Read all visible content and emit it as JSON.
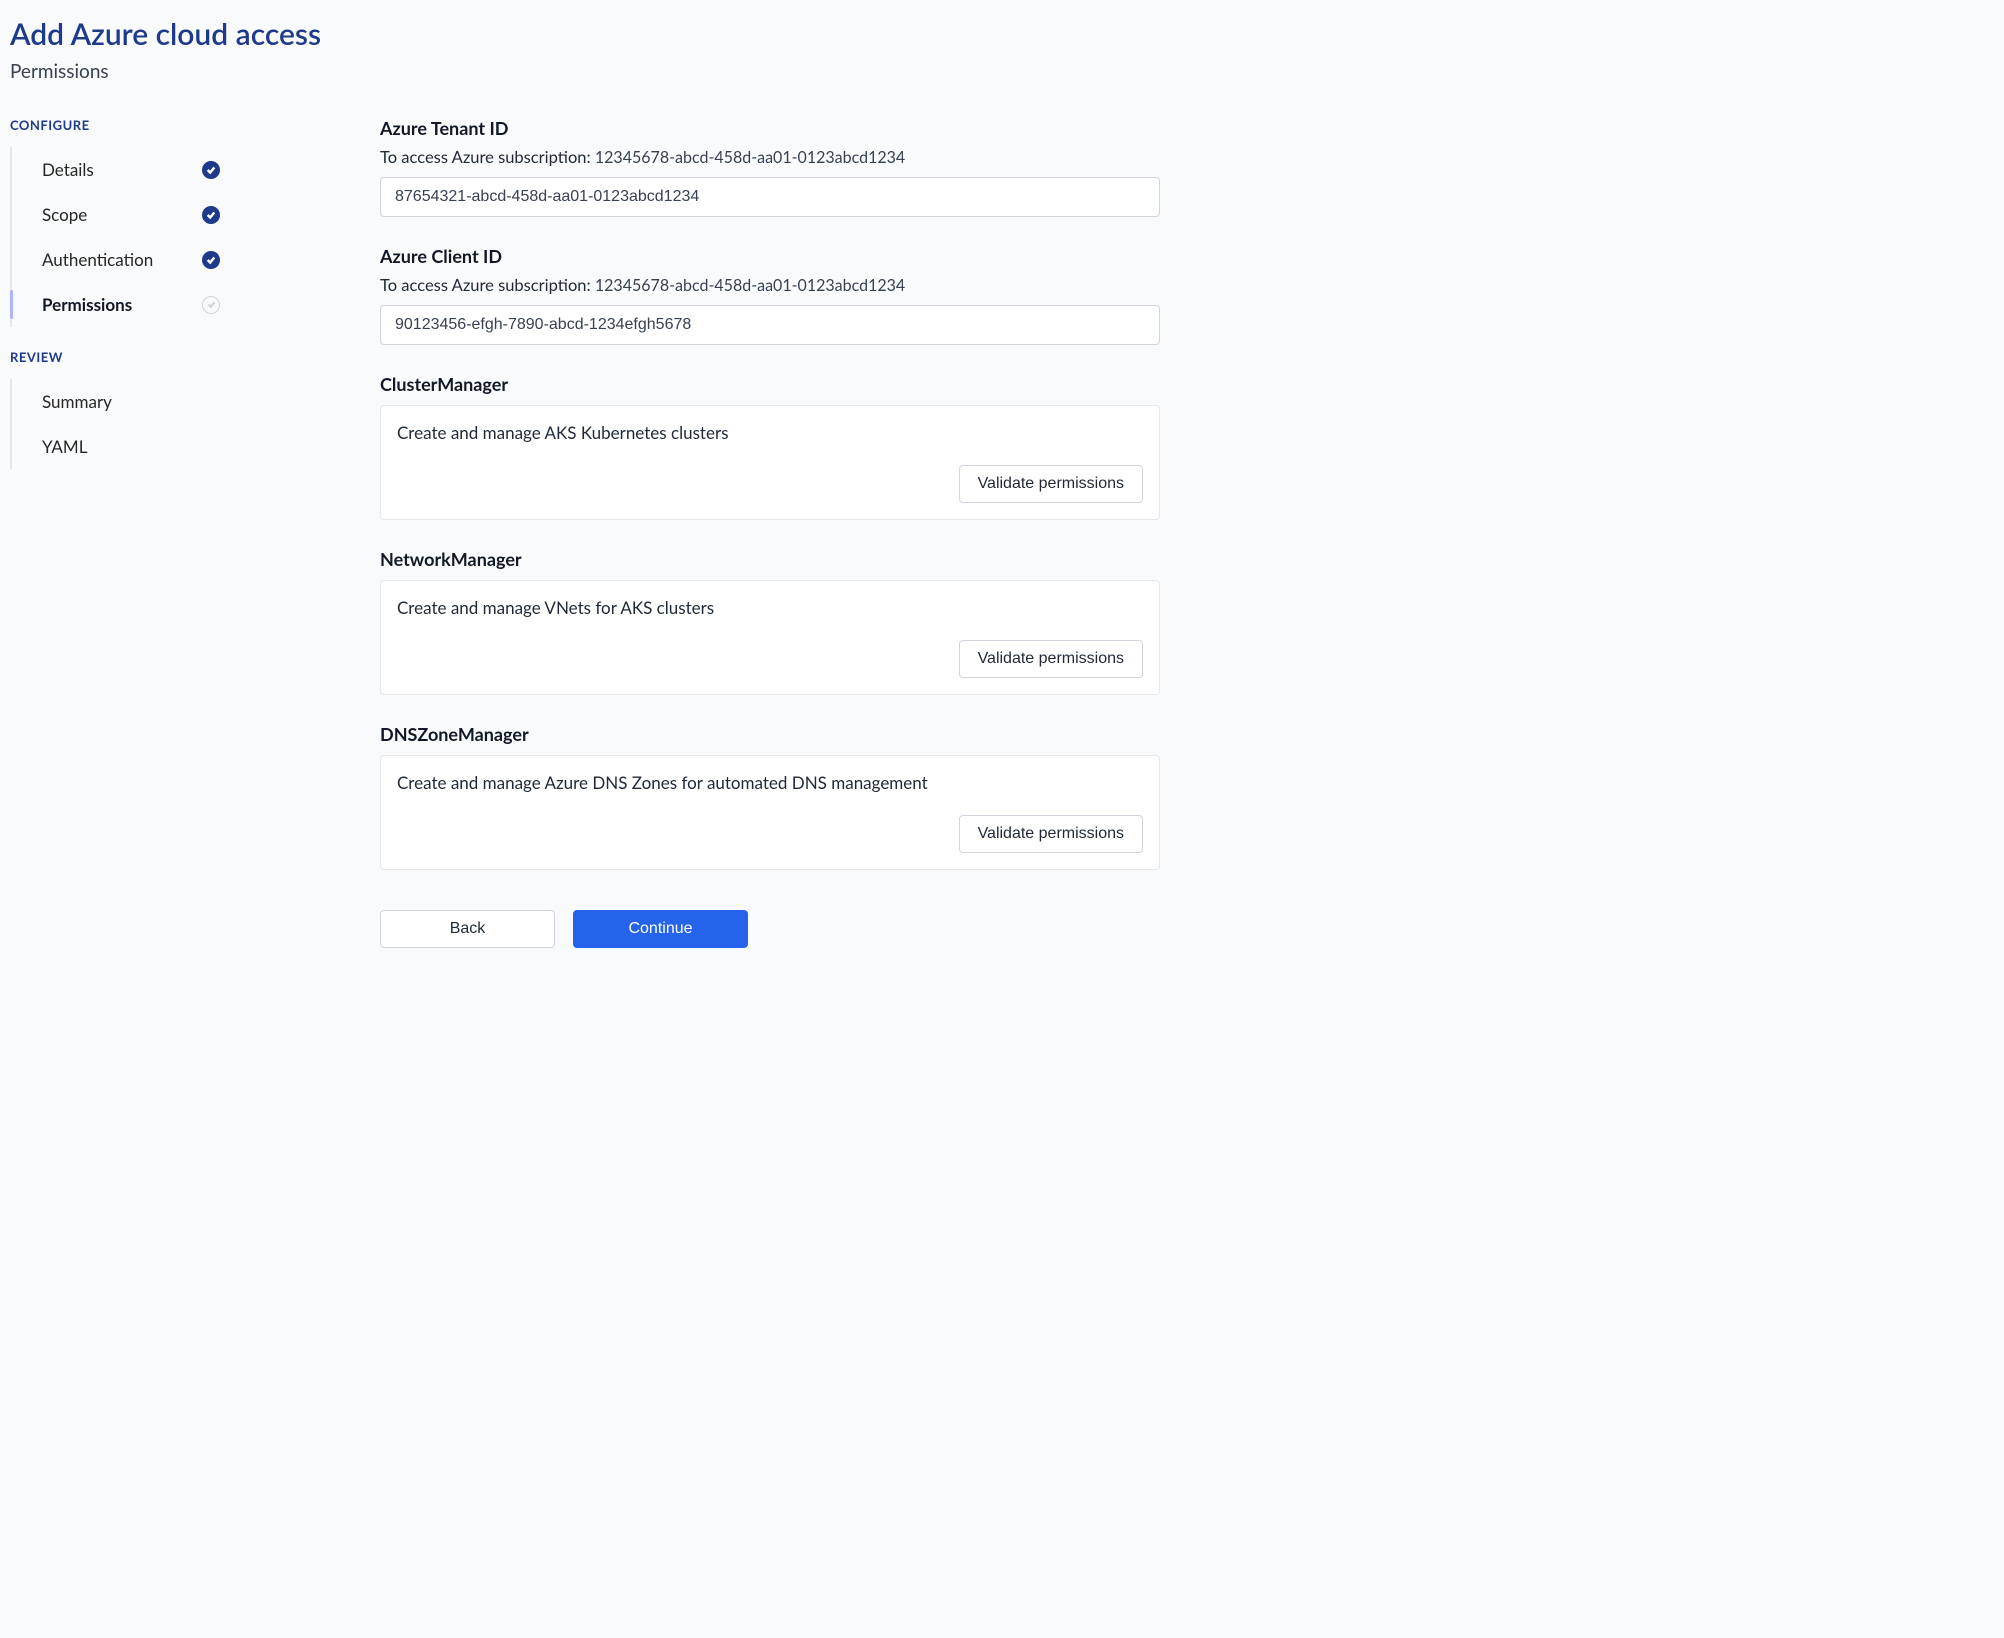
{
  "header": {
    "title": "Add Azure cloud access",
    "subtitle": "Permissions"
  },
  "sidebar": {
    "sections": [
      {
        "label": "CONFIGURE",
        "items": [
          {
            "label": "Details",
            "status": "done",
            "active": false
          },
          {
            "label": "Scope",
            "status": "done",
            "active": false
          },
          {
            "label": "Authentication",
            "status": "done",
            "active": false
          },
          {
            "label": "Permissions",
            "status": "pending",
            "active": true
          }
        ]
      },
      {
        "label": "REVIEW",
        "items": [
          {
            "label": "Summary",
            "status": "none",
            "active": false
          },
          {
            "label": "YAML",
            "status": "none",
            "active": false
          }
        ]
      }
    ]
  },
  "form": {
    "tenant": {
      "label": "Azure Tenant ID",
      "help_prefix": "To access Azure subscription:",
      "subscription_id": "12345678-abcd-458d-aa01-0123abcd1234",
      "value": "87654321-abcd-458d-aa01-0123abcd1234"
    },
    "client": {
      "label": "Azure Client ID",
      "help_prefix": "To access Azure subscription:",
      "subscription_id": "12345678-abcd-458d-aa01-0123abcd1234",
      "value": "90123456-efgh-7890-abcd-1234efgh5678"
    },
    "permissions": [
      {
        "title": "ClusterManager",
        "desc": "Create and manage AKS Kubernetes clusters",
        "button": "Validate permissions"
      },
      {
        "title": "NetworkManager",
        "desc": "Create and manage VNets for AKS clusters",
        "button": "Validate permissions"
      },
      {
        "title": "DNSZoneManager",
        "desc": "Create and manage Azure DNS Zones for automated DNS management",
        "button": "Validate permissions"
      }
    ],
    "footer": {
      "back": "Back",
      "continue": "Continue"
    }
  }
}
